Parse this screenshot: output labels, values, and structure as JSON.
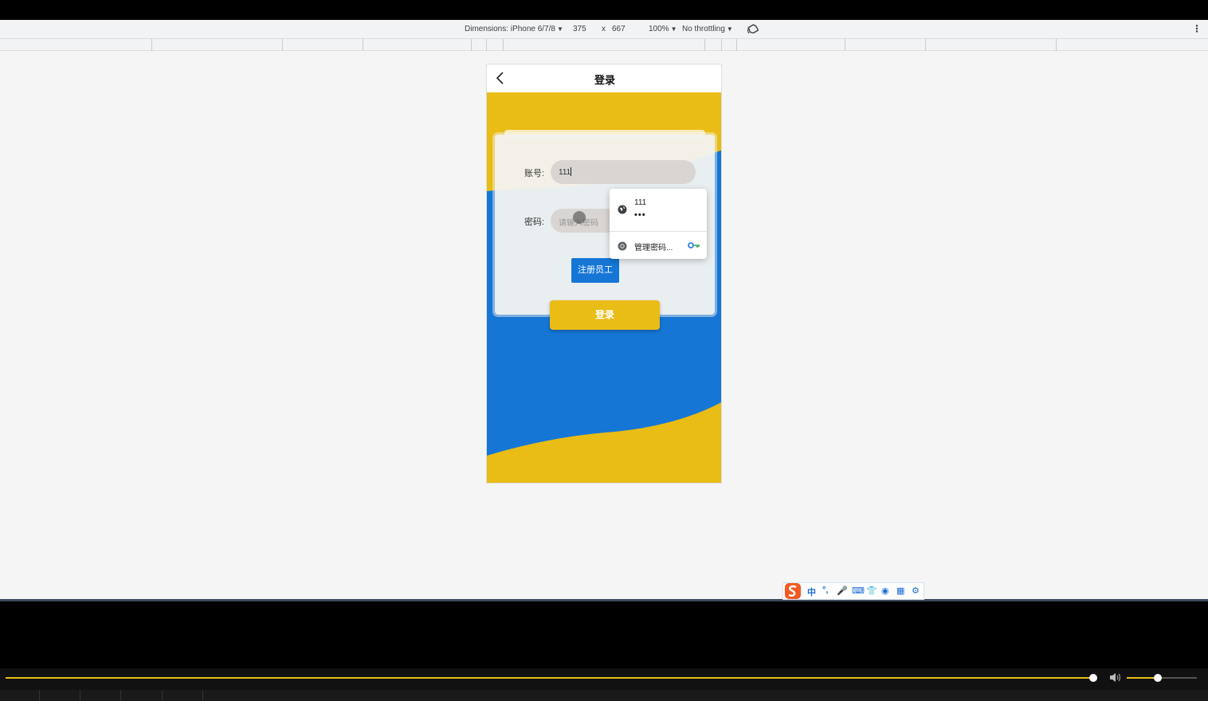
{
  "devtools": {
    "dimensions_label": "Dimensions: iPhone 6/7/8",
    "width": "375",
    "times": "x",
    "height": "667",
    "zoom": "100%",
    "throttling": "No throttling"
  },
  "page": {
    "nav_title": "登录",
    "account_label": "账号:",
    "account_value": "111",
    "password_label": "密码:",
    "password_placeholder": "请输入密码",
    "register_button": "注册员工",
    "login_button": "登录"
  },
  "autofill": {
    "username": "111",
    "password_mask": "•••",
    "manage_label": "管理密码..."
  },
  "ime": {
    "items": [
      "中",
      "°,",
      "🎤",
      "⌨",
      "👕",
      "◉",
      "▦",
      "⚙"
    ]
  },
  "player": {
    "progress": 0.9,
    "volume": 0.4
  },
  "colors": {
    "yellow": "#e9bc16",
    "blue": "#1576d6"
  }
}
